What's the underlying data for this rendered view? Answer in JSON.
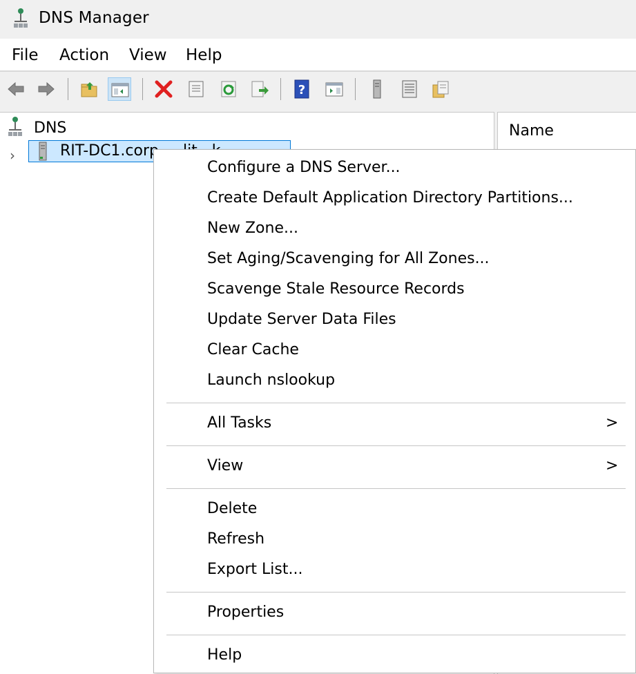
{
  "window": {
    "title": "DNS Manager"
  },
  "menubar": {
    "items": [
      "File",
      "Action",
      "View",
      "Help"
    ]
  },
  "toolbar": {
    "buttons": [
      "back-icon",
      "forward-icon",
      "up-folder-icon",
      "show-hide-console-tree-icon",
      "delete-icon",
      "properties-icon",
      "refresh-icon",
      "export-list-icon",
      "help-icon",
      "show-hide-action-pane-icon",
      "server-icon",
      "list-icon",
      "zones-icon"
    ]
  },
  "tree": {
    "root_label": "DNS",
    "server_label": "RIT-DC1.corp.....lit...k"
  },
  "list": {
    "column_name": "Name"
  },
  "context_menu": {
    "items": {
      "configure": "Configure a DNS Server...",
      "create_partitions": "Create Default Application Directory Partitions...",
      "new_zone": "New Zone...",
      "set_aging": "Set Aging/Scavenging for All Zones...",
      "scavenge": "Scavenge Stale Resource Records",
      "update_files": "Update Server Data Files",
      "clear_cache": "Clear Cache",
      "launch_nslookup": "Launch nslookup",
      "all_tasks": "All Tasks",
      "view": "View",
      "delete": "Delete",
      "refresh": "Refresh",
      "export_list": "Export List...",
      "properties": "Properties",
      "help": "Help"
    },
    "submenu_arrow": ">"
  },
  "colors": {
    "selection_bg": "#cce8ff",
    "selection_border": "#0078d7",
    "chrome": "#f0f0f0"
  }
}
